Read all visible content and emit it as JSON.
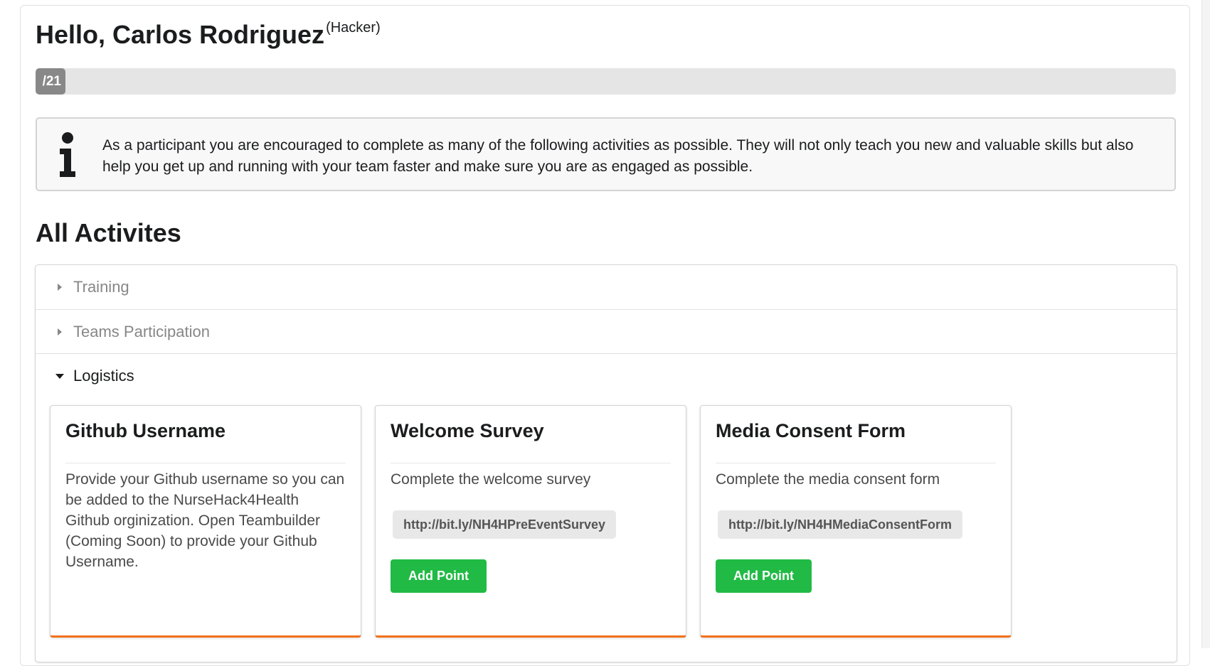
{
  "header": {
    "greeting": "Hello, Carlos Rodriguez",
    "role": "(Hacker)"
  },
  "progress": {
    "label": "/21",
    "fraction": 0.025,
    "bar_color": "#888888"
  },
  "info": {
    "icon": "info-icon",
    "text": "As a participant you are encouraged to complete as many of the following activities as possible. They will not only teach you new and valuable skills but also help you get up and running with your team faster and make sure you are as engaged as possible."
  },
  "section_title": "All Activites",
  "accordion": {
    "items": [
      {
        "label": "Training",
        "expanded": false
      },
      {
        "label": "Teams Participation",
        "expanded": false
      },
      {
        "label": "Logistics",
        "expanded": true
      }
    ]
  },
  "cards": [
    {
      "title": "Github Username",
      "description": "Provide your Github username so you can be added to the NurseHack4Health Github orginization. Open Teambuilder (Coming Soon) to provide your Github Username."
    },
    {
      "title": "Welcome Survey",
      "description": "Complete the welcome survey",
      "link": "http://bit.ly/NH4HPreEventSurvey",
      "button": "Add Point"
    },
    {
      "title": "Media Consent Form",
      "description": "Complete the media consent form",
      "link": "http://bit.ly/NH4HMediaConsentForm",
      "button": "Add Point"
    }
  ],
  "colors": {
    "button_green": "#21ba45",
    "card_accent_orange": "#f2711c"
  }
}
